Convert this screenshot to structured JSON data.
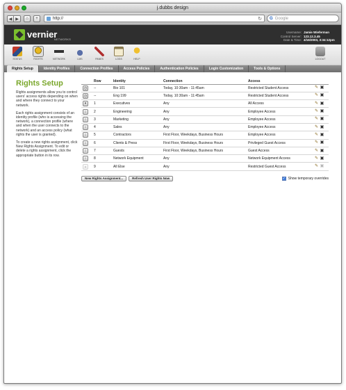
{
  "window": {
    "title": "j.dubbs design"
  },
  "browser": {
    "url": "http://",
    "search_placeholder": "Google"
  },
  "header": {
    "brand": "vernier",
    "brand_sub": "NETWORKS",
    "user_labels": [
      "Username:",
      "Control Server:",
      "Date & Time:"
    ],
    "user_values": [
      "Jamie Wieferman",
      "123.12.3.45",
      "4/16/2003, 3:34:12pm"
    ]
  },
  "nav_icons": [
    {
      "label": "STATUS",
      "icon": "status-icon",
      "color": "#c0392b"
    },
    {
      "label": "RIGHTS",
      "icon": "rights-icon",
      "color": "#d4a017"
    },
    {
      "label": "NETWORK",
      "icon": "network-icon",
      "color": "#444444"
    },
    {
      "label": "LMS",
      "icon": "lock-icon",
      "color": "#5a6fa8"
    },
    {
      "label": "PANES",
      "icon": "pen-icon",
      "color": "#b03030"
    },
    {
      "label": "LOGS",
      "icon": "logs-icon",
      "color": "#8a7a50"
    },
    {
      "label": "HELP",
      "icon": "help-icon",
      "color": "#e0b020"
    }
  ],
  "logout": {
    "label": "LOGOUT"
  },
  "tabs": [
    "Rights Setup",
    "Identity Profiles",
    "Connection Profiles",
    "Access Policies",
    "Authentication Policies",
    "Login Customization",
    "Tools & Options"
  ],
  "page": {
    "title": "Rights Setup",
    "desc1": "Rights assignments allow you to control users' access rights depending on when and where they connect to your network.",
    "desc2": "Each rights assignment consists of an identity profile (who is accessing the network), a connection profile (where and when the user connects to the network) and an access policy (what rights the user is granted).",
    "desc3": "To create a new rights assignment, click New Rights Assignment. To edit or delete a rights assignment, click the appropriate button in its row."
  },
  "table": {
    "headers": [
      "Row",
      "Identity",
      "Connection",
      "Access"
    ],
    "rows": [
      {
        "row": "--",
        "identity": "Bio 101",
        "connection": "Today, 10:30am - 11:45am",
        "access": "Restricted Student Access"
      },
      {
        "row": "--",
        "identity": "Eng 199",
        "connection": "Today, 10:30am - 11:45am",
        "access": "Restricted Student Access"
      },
      {
        "row": "1",
        "identity": "Executives",
        "connection": "Any",
        "access": "All Access"
      },
      {
        "row": "2",
        "identity": "Engineering",
        "connection": "Any",
        "access": "Employee Access"
      },
      {
        "row": "3",
        "identity": "Marketing",
        "connection": "Any",
        "access": "Employee Access"
      },
      {
        "row": "4",
        "identity": "Sales",
        "connection": "Any",
        "access": "Employee Access"
      },
      {
        "row": "5",
        "identity": "Contractors",
        "connection": "First Floor, Weekdays, Business Hours",
        "access": "Employee Access"
      },
      {
        "row": "6",
        "identity": "Clients & Press",
        "connection": "First Floor, Weekdays, Business Hours",
        "access": "Privileged Guest Access"
      },
      {
        "row": "7",
        "identity": "Guests",
        "connection": "First Floor, Weekdays, Business Hours",
        "access": "Guest Access"
      },
      {
        "row": "8",
        "identity": "Network Equipment",
        "connection": "Any",
        "access": "Network Equipment Access"
      },
      {
        "row": "9",
        "identity": "All Else",
        "connection": "Any",
        "access": "Restricted Guest Access"
      }
    ]
  },
  "actions": {
    "new_label": "New Rights Assignment...",
    "refresh_label": "Refresh User Rights Now",
    "temp_label": "Show temporary overrides",
    "temp_checked": true
  }
}
